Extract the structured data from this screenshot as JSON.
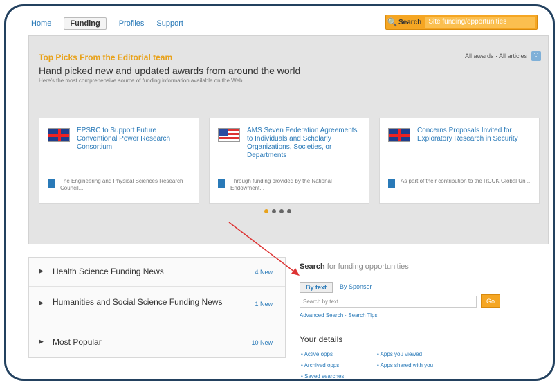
{
  "nav": {
    "tabs": [
      {
        "label": "Home"
      },
      {
        "label": "Funding"
      },
      {
        "label": "Profiles"
      },
      {
        "label": "Support"
      }
    ],
    "search_label": "Search",
    "search_placeholder": "Site funding/opportunities"
  },
  "editorial": {
    "heading": "Top Picks From the Editorial team",
    "links": "All awards · All articles",
    "title": "Hand picked new and updated awards from around the world",
    "subtitle": "Here's the most comprehensive source of funding information available on the Web",
    "cards": [
      {
        "flag": "uk-flag-icon",
        "title": "EPSRC to Support Future Conventional Power Research Consortium",
        "desc": "The Engineering and Physical Sciences Research Council..."
      },
      {
        "flag": "us-flag-icon",
        "title": "AMS Seven Federation Agreements to Individuals and Scholarly Organizations, Societies, or Departments",
        "desc": "Through funding provided by the National Endowment..."
      },
      {
        "flag": "uk-flag-icon",
        "title": "Concerns Proposals Invited for Exploratory Research in Security",
        "desc": "As part of their contribution to the RCUK Global Un..."
      }
    ]
  },
  "news": {
    "rows": [
      {
        "label": "Health Science Funding News",
        "count": "4 New"
      },
      {
        "label": "Humanities and Social Science Funding News",
        "count": "1 New"
      },
      {
        "label": "Most Popular",
        "count": "10 New"
      }
    ]
  },
  "search": {
    "title_bold": "Search",
    "title_rest": "for funding opportunities",
    "tab_active": "By text",
    "tab_other": "By Sponsor",
    "placeholder": "Search by text",
    "go": "Go",
    "advanced": "Advanced Search · Search Tips"
  },
  "details": {
    "title": "Your details",
    "links": [
      {
        "label": "Active opps"
      },
      {
        "label": "Apps you viewed"
      },
      {
        "label": "Archived opps"
      },
      {
        "label": "Apps shared with you"
      },
      {
        "label": "Saved searches"
      }
    ]
  }
}
